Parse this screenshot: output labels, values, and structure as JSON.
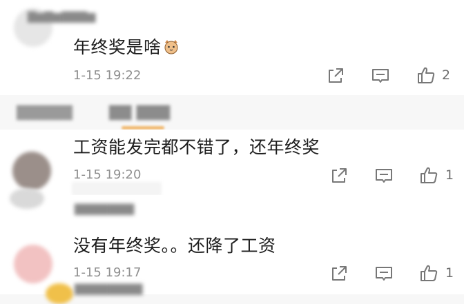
{
  "comments": [
    {
      "text": "年终奖是啥",
      "time": "1-15 19:22",
      "likes": "2"
    },
    {
      "text": "工资能发完都不错了，还年终奖",
      "time": "1-15 19:20",
      "likes": "1"
    },
    {
      "text": "没有年终奖。。还降了工资",
      "time": "1-15 19:17",
      "likes": "1"
    }
  ],
  "icons": {
    "share": "share-icon",
    "reply": "comment-icon",
    "like": "thumbs-up-icon",
    "emoji": "cat-emoji-icon"
  },
  "colors": {
    "text": "#1d1d1d",
    "meta": "#8f8f8f",
    "icon": "#777777",
    "tab_underline": "#f0b66a",
    "divider_bg": "#f7f7f7"
  }
}
